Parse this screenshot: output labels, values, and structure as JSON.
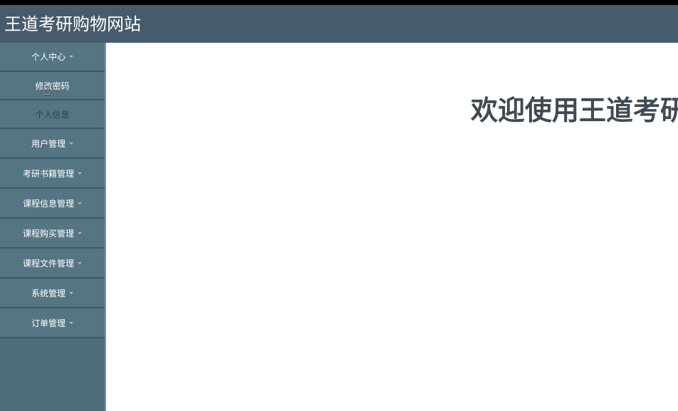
{
  "header": {
    "site_title": "王道考研购物网站"
  },
  "sidebar": {
    "menu": [
      {
        "label": "个人中心",
        "expanded": true,
        "children": [
          {
            "label": "修改密码",
            "state": "hover"
          },
          {
            "label": "个人信息",
            "state": "normal"
          }
        ]
      },
      {
        "label": "用户管理"
      },
      {
        "label": "考研书籍管理"
      },
      {
        "label": "课程信息管理"
      },
      {
        "label": "课程购买管理"
      },
      {
        "label": "课程文件管理"
      },
      {
        "label": "系统管理"
      },
      {
        "label": "订单管理"
      }
    ]
  },
  "main": {
    "welcome_text": "欢迎使用王道考研购物网站"
  },
  "icons": {
    "caret": "caret-down-icon",
    "cursor": "hand-pointer-icon"
  },
  "colors": {
    "topbar": "#465b6b",
    "sidebar": "#557582",
    "heading": "#3f4a54"
  }
}
